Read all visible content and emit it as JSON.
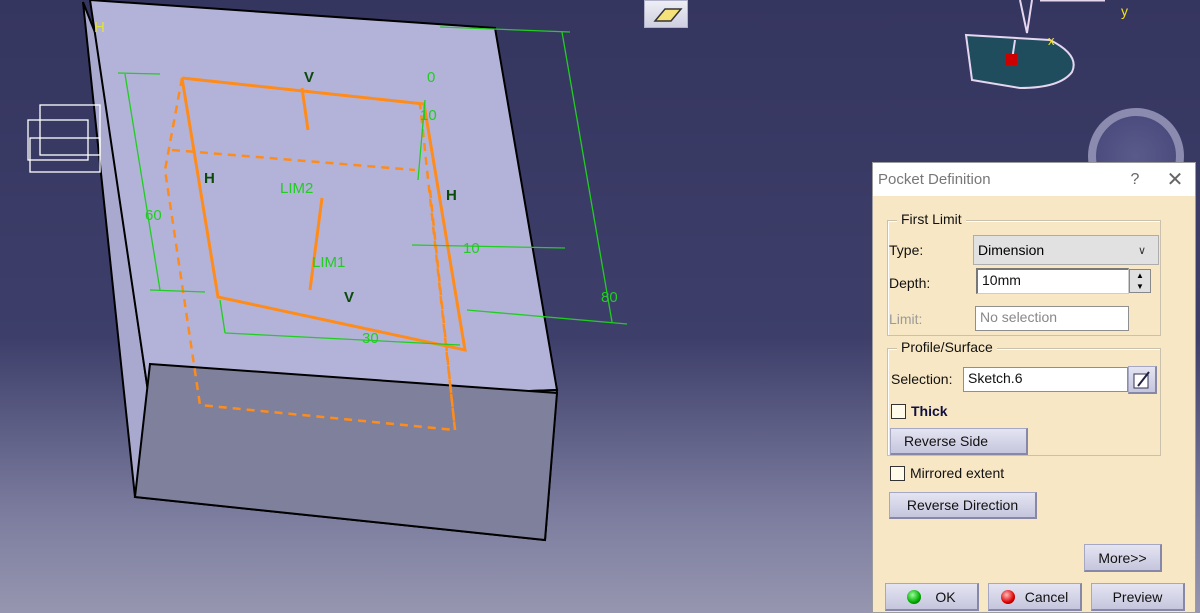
{
  "viewport": {
    "annotations": {
      "v_top": "V",
      "v_bottom": "V",
      "h_left": "H",
      "h_right": "H",
      "h_corner": "H",
      "lim1": "LIM1",
      "lim2": "LIM2",
      "dim_60": "60",
      "dim_80": "80",
      "dim_30": "30",
      "dim_10_right": "10",
      "dim_10_top": "10",
      "dim_0": "0"
    },
    "compass": {
      "x_label": "x",
      "y_label": "y"
    },
    "colors": {
      "profile": "#ff8c1a",
      "constraints": "#22cc22",
      "face_top": "#b3b3d9",
      "face_front": "#7f809c"
    }
  },
  "dialog": {
    "title": "Pocket Definition",
    "help": "?",
    "close": "✕",
    "first_limit": {
      "legend": "First Limit",
      "type_label": "Type:",
      "type_value": "Dimension",
      "depth_label": "Depth:",
      "depth_value": "10mm",
      "limit_label": "Limit:",
      "limit_value": "No selection"
    },
    "profile": {
      "legend": "Profile/Surface",
      "selection_label": "Selection:",
      "selection_value": "Sketch.6",
      "thick_label": "Thick",
      "thick_checked": false,
      "reverse_side": "Reverse Side"
    },
    "mirrored_label": "Mirrored extent",
    "mirrored_checked": false,
    "reverse_direction": "Reverse Direction",
    "more": "More>>",
    "ok": "OK",
    "cancel": "Cancel",
    "preview": "Preview"
  }
}
